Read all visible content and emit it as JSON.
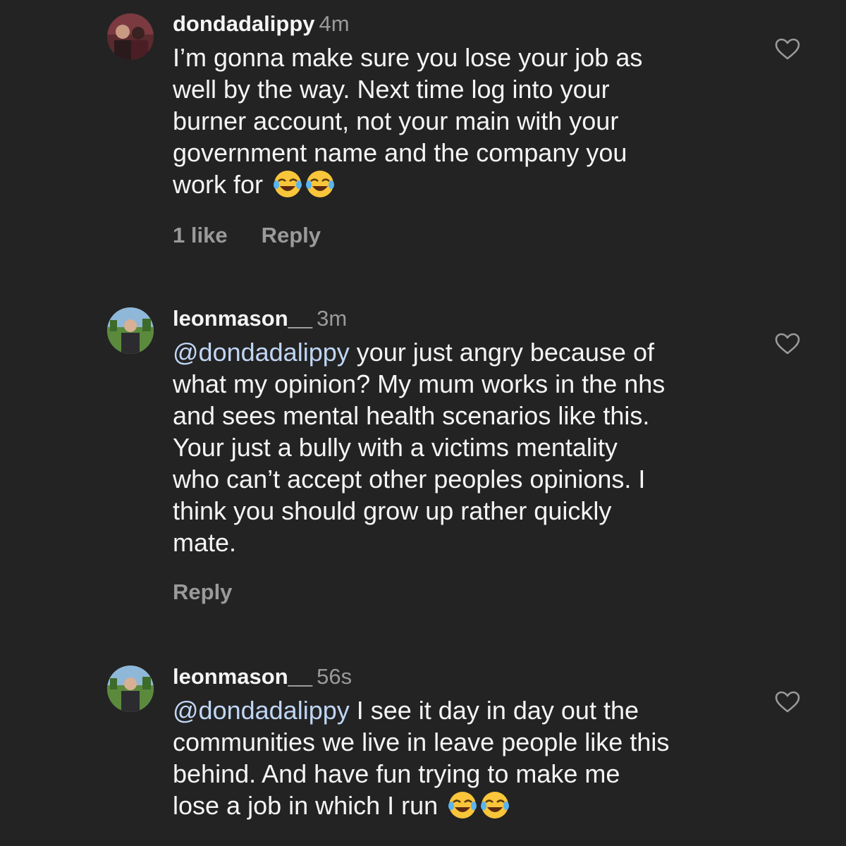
{
  "colors": {
    "background": "#232323",
    "text": "#f5f5f5",
    "secondary": "#9a9a9a",
    "mention": "#c0d6f5"
  },
  "comments": [
    {
      "username": "dondadalippy",
      "time": "4m",
      "text": "I’m gonna make sure you lose your job as\nwell by the way. Next time log into your\nburner account, not your main with your\ngovernment name and the company you\nwork for ",
      "emojis": [
        "face-with-tears-of-joy",
        "face-with-tears-of-joy"
      ],
      "likes": "1 like",
      "reply": "Reply"
    },
    {
      "username": "leonmason__",
      "time": "3m",
      "mention": "@dondadalippy",
      "text": " your just angry because of\nwhat my opinion? My mum works in the nhs\nand sees mental health scenarios like this.\nYour just a bully with a victims mentality\nwho can’t accept other peoples opinions. I\nthink you should grow up rather quickly\nmate.",
      "reply": "Reply"
    },
    {
      "username": "leonmason__",
      "time": "56s",
      "mention": "@dondadalippy",
      "text": " I see it day in day out the\ncommunities we live in leave people like this\nbehind. And have fun trying to make me\nlose a job in which I run ",
      "emojis": [
        "face-with-tears-of-joy",
        "face-with-tears-of-joy"
      ]
    }
  ]
}
